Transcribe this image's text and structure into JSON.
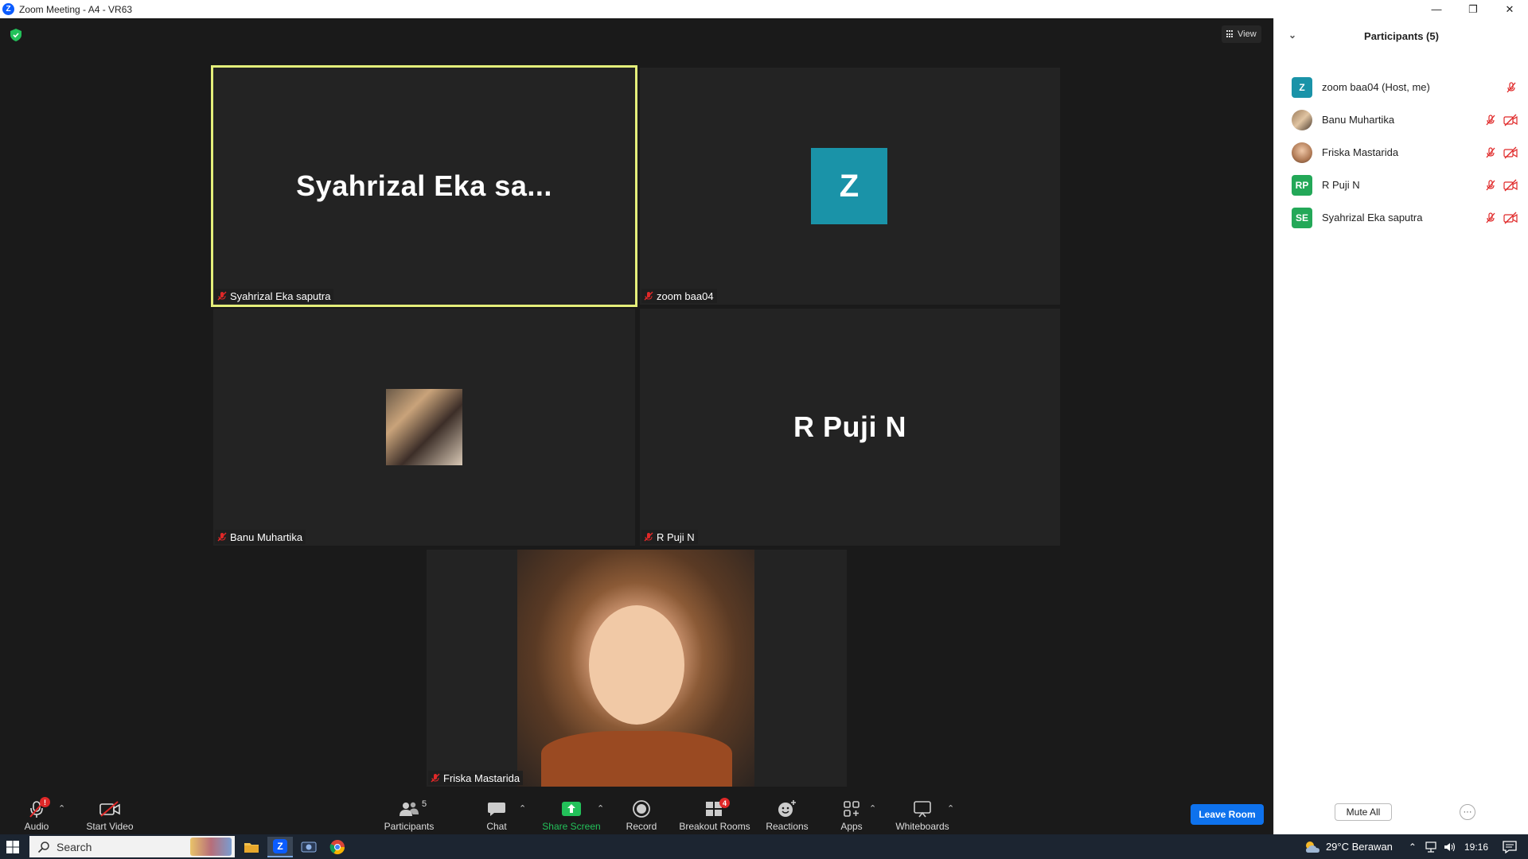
{
  "window": {
    "title": "Zoom Meeting - A4 - VR63"
  },
  "view_button": {
    "label": "View"
  },
  "tiles": [
    {
      "big_name": "Syahrizal  Eka  sa...",
      "label": "Syahrizal Eka saputra"
    },
    {
      "avatar_letter": "Z",
      "label": "zoom baa04"
    },
    {
      "label": "Banu Muhartika"
    },
    {
      "big_name": "R Puji N",
      "label": "R Puji N"
    },
    {
      "label": "Friska Mastarida"
    }
  ],
  "toolbar": {
    "audio": "Audio",
    "start_video": "Start Video",
    "participants": "Participants",
    "participants_count": "5",
    "chat": "Chat",
    "share_screen": "Share Screen",
    "record": "Record",
    "breakout_rooms": "Breakout Rooms",
    "breakout_count": "4",
    "reactions": "Reactions",
    "apps": "Apps",
    "whiteboards": "Whiteboards",
    "leave_room": "Leave Room",
    "audio_badge": "!"
  },
  "panel": {
    "title": "Participants (5)",
    "participants": [
      {
        "initials": "Z",
        "name": "zoom baa04 (Host, me)",
        "color": "#1a93a8"
      },
      {
        "initials": "",
        "name": "Banu Muhartika"
      },
      {
        "initials": "",
        "name": "Friska Mastarida"
      },
      {
        "initials": "RP",
        "name": "R Puji N",
        "color": "#23a858"
      },
      {
        "initials": "SE",
        "name": "Syahrizal Eka saputra",
        "color": "#23a858"
      }
    ],
    "mute_all": "Mute All",
    "more": "···"
  },
  "taskbar": {
    "search_placeholder": "Search",
    "weather": "29°C  Berawan",
    "time": "19:16"
  },
  "colors": {
    "active_speaker_border": "#e4ee7a",
    "leave_button": "#0e72ed",
    "muted_red": "#e02828",
    "share_green": "#23c15a"
  }
}
